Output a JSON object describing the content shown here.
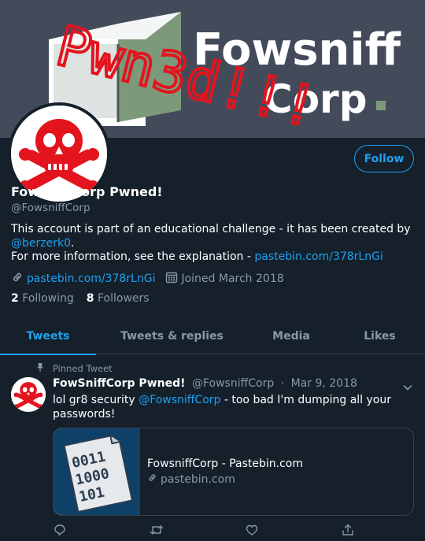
{
  "banner": {
    "company_text_line1": "Fowsniff",
    "company_text_line2": "Corp",
    "graffiti_text": "Pwn3d!!!"
  },
  "profile": {
    "name": "FowSniffCorp Pwned!",
    "handle": "@FowsniffCorp",
    "follow_label": "Follow",
    "bio_line1": "This account is part of an educational challenge - it has been created by",
    "bio_mention": "@berzerk0",
    "bio_period": ".",
    "bio_line2": "For more information, see the explanation - ",
    "bio_link": "pastebin.com/378rLnGi",
    "website": "pastebin.com/378rLnGi",
    "joined": "Joined March 2018",
    "following_count": "2",
    "following_label": "Following",
    "followers_count": "8",
    "followers_label": "Followers"
  },
  "tabs": [
    {
      "label": "Tweets",
      "active": true
    },
    {
      "label": "Tweets & replies",
      "active": false
    },
    {
      "label": "Media",
      "active": false
    },
    {
      "label": "Likes",
      "active": false
    }
  ],
  "tweet": {
    "pinned_label": "Pinned Tweet",
    "author_name": "FowSniffCorp Pwned!",
    "author_handle": "@FowsniffCorp",
    "separator": "·",
    "date": "Mar 9, 2018",
    "text_before": "lol gr8 security ",
    "text_mention": "@FowsniffCorp",
    "text_after": " - too bad I'm dumping all your passwords!",
    "card_title": "FowsniffCorp - Pastebin.com",
    "card_domain": "pastebin.com",
    "card_image_lines": [
      "0011",
      "1000",
      "101"
    ]
  },
  "icons": {
    "link": "link-icon",
    "calendar": "calendar-icon",
    "pin": "pin-icon",
    "chevron": "chevron-down-icon",
    "reply": "reply-icon",
    "retweet": "retweet-icon",
    "like": "heart-icon",
    "share": "share-icon"
  },
  "colors": {
    "background": "#15202b",
    "accent": "#1da1f2",
    "secondary_text": "#8899a6",
    "border": "#38444d",
    "banner": "#434b5b",
    "graffiti": "#e3141e"
  }
}
